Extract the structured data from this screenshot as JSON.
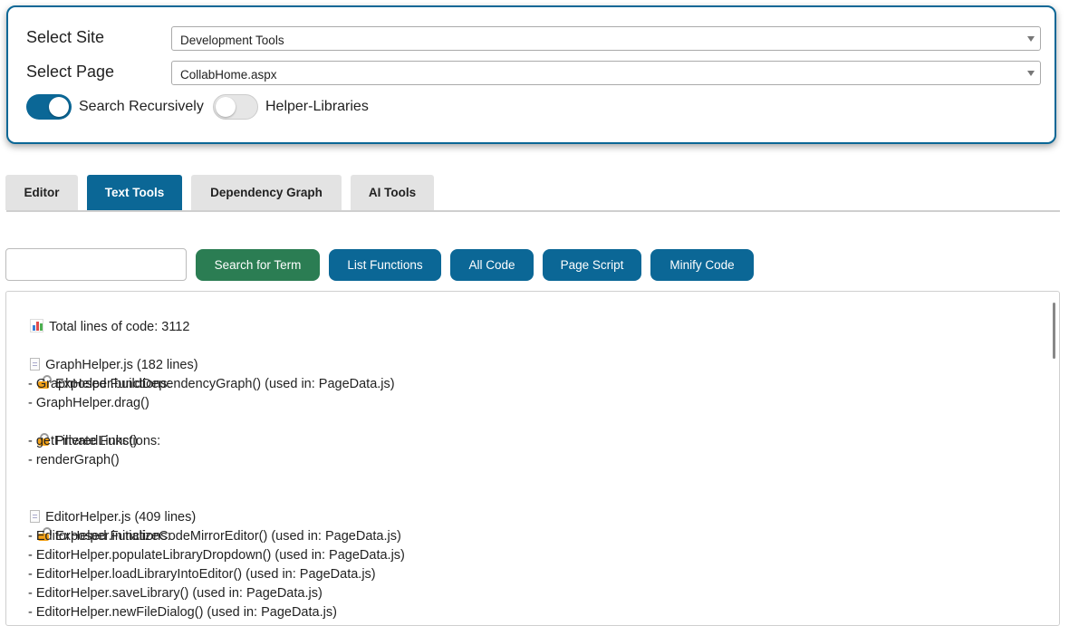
{
  "selectors": {
    "site_label": "Select Site",
    "site_value": "Development Tools",
    "page_label": "Select Page",
    "page_value": "CollabHome.aspx"
  },
  "toggles": {
    "recursive_label": "Search Recursively",
    "recursive_on": true,
    "helpers_label": "Helper-Libraries",
    "helpers_on": false
  },
  "tabs": [
    {
      "label": "Editor",
      "active": false
    },
    {
      "label": "Text Tools",
      "active": true
    },
    {
      "label": "Dependency Graph",
      "active": false
    },
    {
      "label": "AI Tools",
      "active": false
    }
  ],
  "search": {
    "value": "",
    "placeholder": ""
  },
  "buttons": {
    "search": "Search for Term",
    "list_functions": "List Functions",
    "all_code": "All Code",
    "page_script": "Page Script",
    "minify": "Minify Code"
  },
  "output": {
    "total": "Total lines of code: 3112",
    "files": [
      {
        "name": "GraphHelper.js (182 lines)",
        "exposed_title": "Exposed Functions:",
        "exposed": [
          "- GraphHelper.buildDependencyGraph() (used in: PageData.js)",
          "- GraphHelper.drag()"
        ],
        "private_title": "Private Functions:",
        "private": [
          "- getFilteredLinks()",
          "- renderGraph()"
        ]
      },
      {
        "name": "EditorHelper.js (409 lines)",
        "exposed_title": "Exposed Functions:",
        "exposed": [
          "- EditorHelper.initializeCodeMirrorEditor() (used in: PageData.js)",
          "- EditorHelper.populateLibraryDropdown() (used in: PageData.js)",
          "- EditorHelper.loadLibraryIntoEditor() (used in: PageData.js)",
          "- EditorHelper.saveLibrary() (used in: PageData.js)",
          "- EditorHelper.newFileDialog() (used in: PageData.js)"
        ]
      }
    ]
  },
  "colors": {
    "primary": "#0b6796",
    "success": "#2b7d53",
    "lock": "#f3a218"
  }
}
